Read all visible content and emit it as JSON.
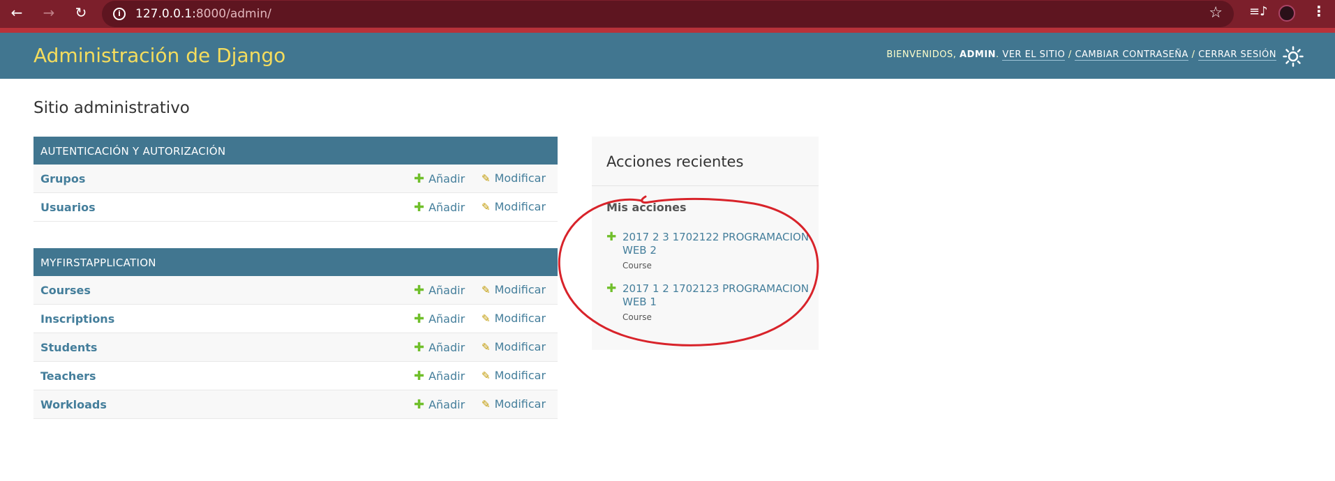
{
  "browser": {
    "url_host": "127.0.0.1:",
    "url_path": "8000/admin/"
  },
  "header": {
    "branding": "Administración de Django",
    "welcome": "Bienvenidos,",
    "username": "admin",
    "view_site": "Ver el sitio",
    "change_password": "Cambiar contraseña",
    "logout": "Cerrar sesión",
    "separator": "/"
  },
  "page": {
    "title": "Sitio administrativo"
  },
  "modules": [
    {
      "caption": "AUTENTICACIÓN Y AUTORIZACIÓN",
      "models": [
        {
          "name": "Grupos",
          "add": "Añadir",
          "change": "Modificar"
        },
        {
          "name": "Usuarios",
          "add": "Añadir",
          "change": "Modificar"
        }
      ]
    },
    {
      "caption": "MYFIRSTAPPLICATION",
      "models": [
        {
          "name": "Courses",
          "add": "Añadir",
          "change": "Modificar"
        },
        {
          "name": "Inscriptions",
          "add": "Añadir",
          "change": "Modificar"
        },
        {
          "name": "Students",
          "add": "Añadir",
          "change": "Modificar"
        },
        {
          "name": "Teachers",
          "add": "Añadir",
          "change": "Modificar"
        },
        {
          "name": "Workloads",
          "add": "Añadir",
          "change": "Modificar"
        }
      ]
    }
  ],
  "recent_actions": {
    "title": "Acciones recientes",
    "subtitle": "Mis acciones",
    "items": [
      {
        "text": "2017 2 3 1702122 PROGRAMACION WEB 2",
        "type": "Course"
      },
      {
        "text": "2017 1 2 1702123 PROGRAMACION WEB 1",
        "type": "Course"
      }
    ]
  },
  "colors": {
    "header_bg": "#417690",
    "branding": "#f5dd5d",
    "link": "#447e9b",
    "add_icon": "#70bf2b",
    "annotation": "#d8232a"
  }
}
